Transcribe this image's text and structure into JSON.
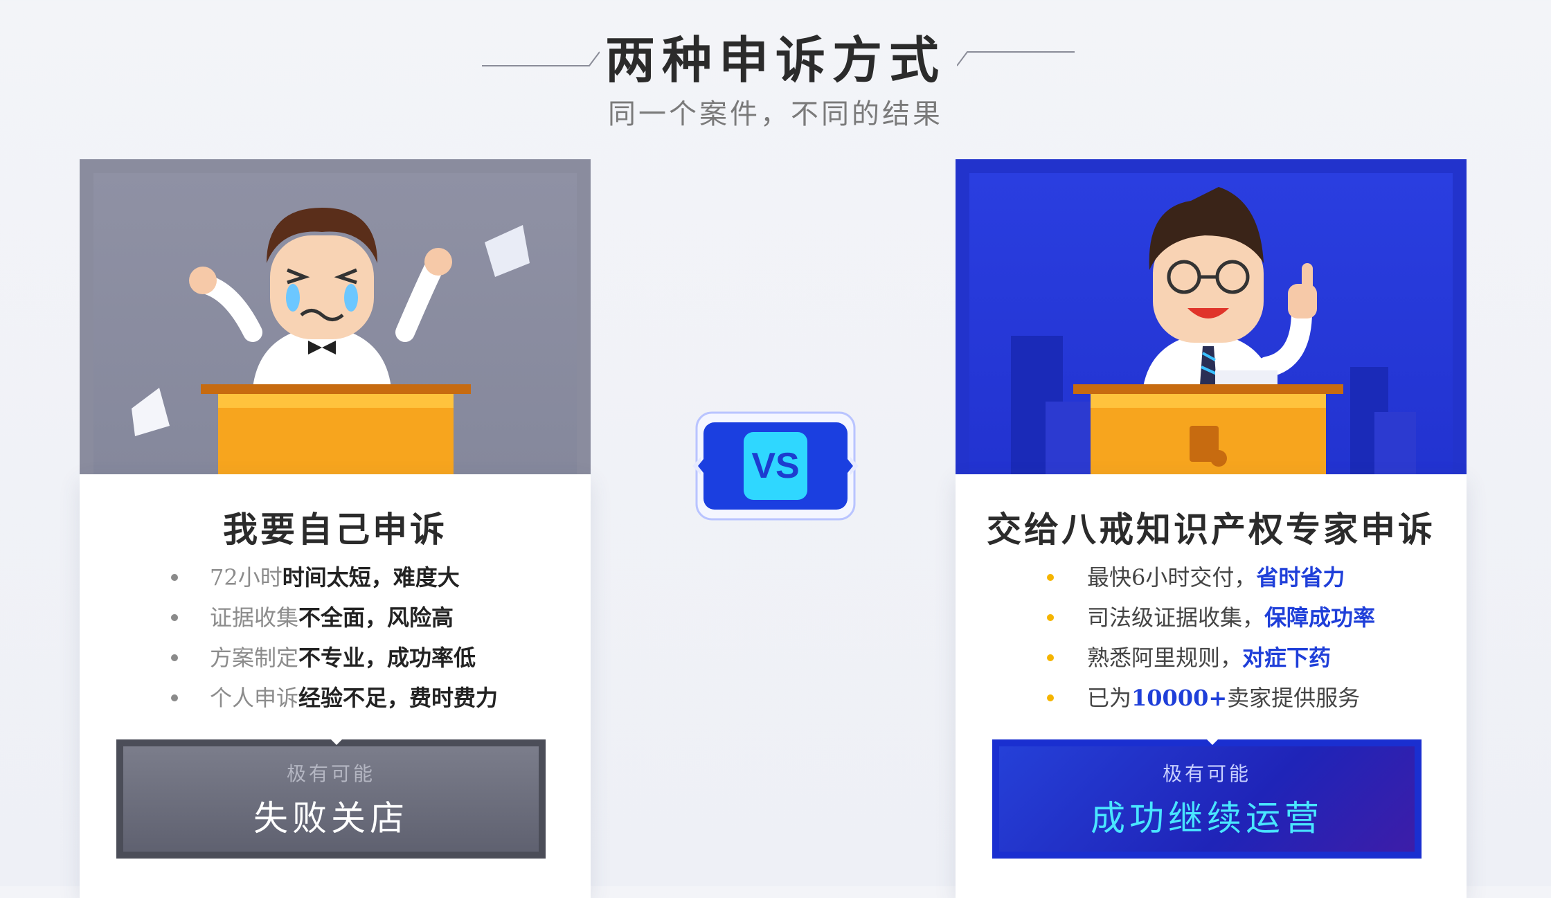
{
  "header": {
    "title": "两种申诉方式",
    "subtitle": "同一个案件，不同的结果"
  },
  "vs": {
    "label": "VS"
  },
  "left_card": {
    "title": "我要自己申诉",
    "items": [
      {
        "a": "72小时",
        "b": "时间太短，难度大"
      },
      {
        "a": "证据收集",
        "b": "不全面，风险高"
      },
      {
        "a": "方案制定",
        "b": "不专业，成功率低"
      },
      {
        "a": "个人申诉",
        "b": "经验不足，费时费力"
      }
    ],
    "footer_small": "极有可能",
    "footer_big": "失败关店"
  },
  "right_card": {
    "title": "交给八戒知识产权专家申诉",
    "items": [
      {
        "a": "最快6小时交付，",
        "b": "省时省力"
      },
      {
        "a": "司法级证据收集，",
        "b": "保障成功率"
      },
      {
        "a": "熟悉阿里规则，",
        "b": "对症下药"
      },
      {
        "a0": "已为",
        "b": "10000+",
        "a": "卖家提供服务"
      }
    ],
    "footer_small": "极有可能",
    "footer_big": "成功继续运营"
  },
  "colors": {
    "accent_blue": "#1f3fd9",
    "cyan": "#49e6ff",
    "bullet_yellow": "#f5b400",
    "gray_card": "#8a8c9e"
  }
}
